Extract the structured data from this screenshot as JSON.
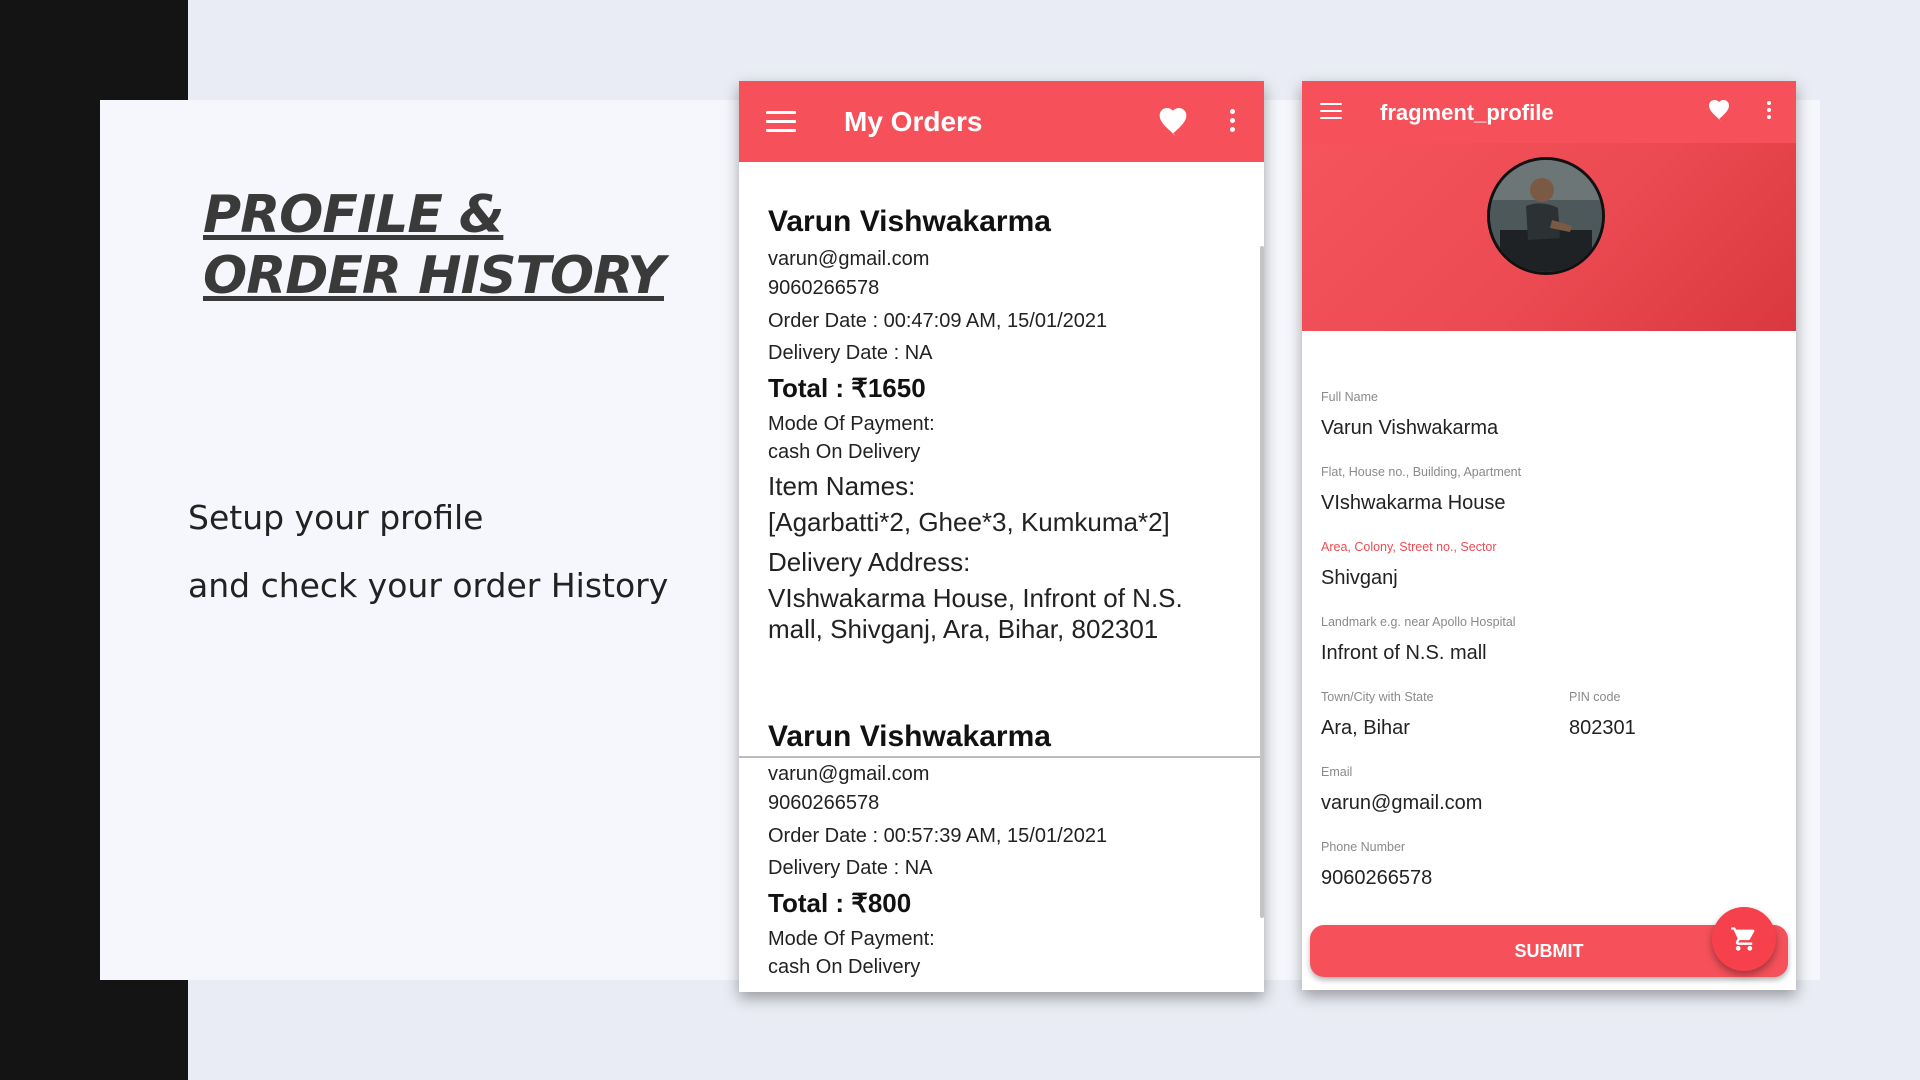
{
  "slide": {
    "title_line1": "PROFILE &",
    "title_line2": "ORDER HISTORY",
    "subtitle_line1": "Setup your profile",
    "subtitle_line2": "and check your order History"
  },
  "orders_screen": {
    "title": "My Orders",
    "icons": [
      "menu-icon",
      "heart-icon",
      "more-vert-icon"
    ],
    "orders": [
      {
        "name": "Varun Vishwakarma",
        "email": "varun@gmail.com",
        "phone": "9060266578",
        "order_date": "Order Date : 00:47:09 AM, 15/01/2021",
        "delivery_date": "Delivery Date : NA",
        "total": "Total : ₹1650",
        "payment_label": "Mode Of Payment:",
        "payment_value": "cash On Delivery",
        "items_label": "Item Names:",
        "items_value": "[Agarbatti*2, Ghee*3, Kumkuma*2]",
        "address_label": "Delivery Address:",
        "address_value": "VIshwakarma House, Infront of N.S. mall, Shivganj, Ara, Bihar, 802301"
      },
      {
        "name": "Varun Vishwakarma",
        "email": "varun@gmail.com",
        "phone": "9060266578",
        "order_date": "Order Date : 00:57:39 AM, 15/01/2021",
        "delivery_date": "Delivery Date : NA",
        "total": "Total : ₹800",
        "payment_label": "Mode Of Payment:",
        "payment_value": "cash On Delivery"
      }
    ]
  },
  "profile_screen": {
    "title": "fragment_profile",
    "icons": [
      "menu-icon",
      "heart-icon",
      "more-vert-icon",
      "cart-icon"
    ],
    "fields": {
      "full_name": {
        "label": "Full Name",
        "value": "Varun Vishwakarma"
      },
      "house": {
        "label": "Flat, House no., Building, Apartment",
        "value": "VIshwakarma House"
      },
      "area": {
        "label": "Area, Colony, Street no., Sector",
        "value": "Shivganj"
      },
      "landmark": {
        "label": "Landmark e.g. near Apollo Hospital",
        "value": "Infront of N.S. mall"
      },
      "city": {
        "label": "Town/City with State",
        "value": "Ara, Bihar"
      },
      "pin": {
        "label": "PIN code",
        "value": "802301"
      },
      "email": {
        "label": "Email",
        "value": "varun@gmail.com"
      },
      "phone": {
        "label": "Phone Number",
        "value": "9060266578"
      }
    },
    "submit_label": "SUBMIT"
  },
  "colors": {
    "accent": "#f6515a",
    "error_label": "#f04a52",
    "slide_bg": "#f5f7fc",
    "page_bg": "#e9ecf4",
    "dark_strip": "#141414"
  }
}
